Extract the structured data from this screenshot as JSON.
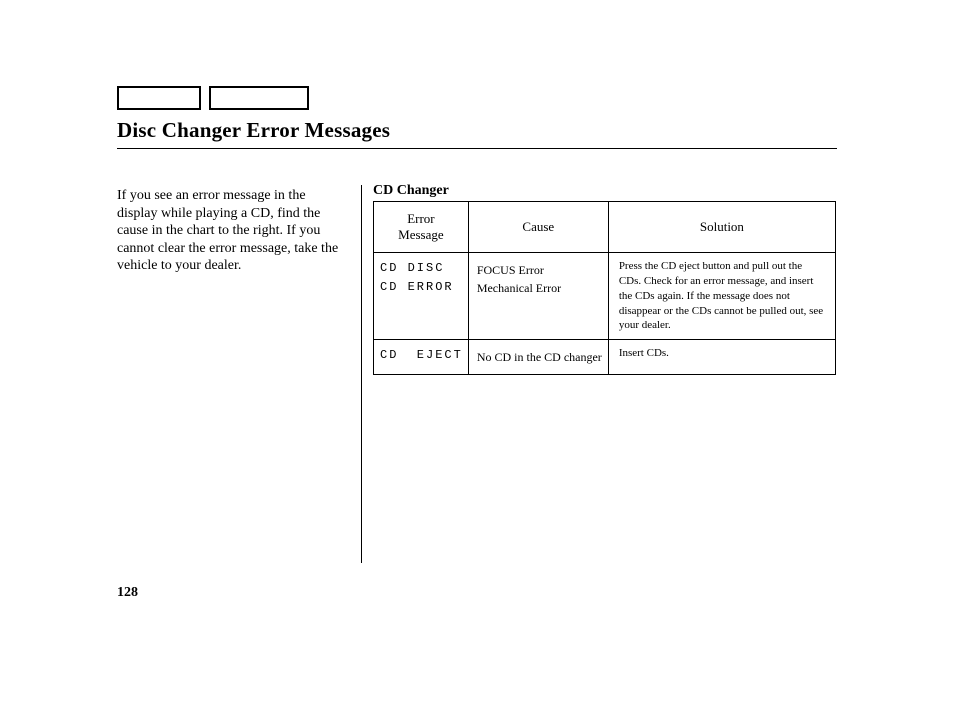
{
  "title": "Disc Changer Error Messages",
  "intro": "If you see an error message in the display while playing a CD, find the cause in the chart to the right. If you cannot clear the error message, take the vehicle to your dealer.",
  "section_label": "CD Changer",
  "table": {
    "headers": {
      "msg": "Error\nMessage",
      "cause": "Cause",
      "solution": "Solution"
    },
    "rows": [
      {
        "msg": "CD   DISC\nCD  ERROR",
        "cause": "FOCUS Error\nMechanical Error",
        "solution": "Press the CD eject button and pull out the CDs. Check for an error message, and insert the CDs again. If the message does not disappear or the CDs cannot be pulled out, see your dealer."
      },
      {
        "msg": "CD  EJECT",
        "cause": "No CD in the CD changer",
        "solution": "Insert CDs."
      }
    ]
  },
  "page_number": "128"
}
